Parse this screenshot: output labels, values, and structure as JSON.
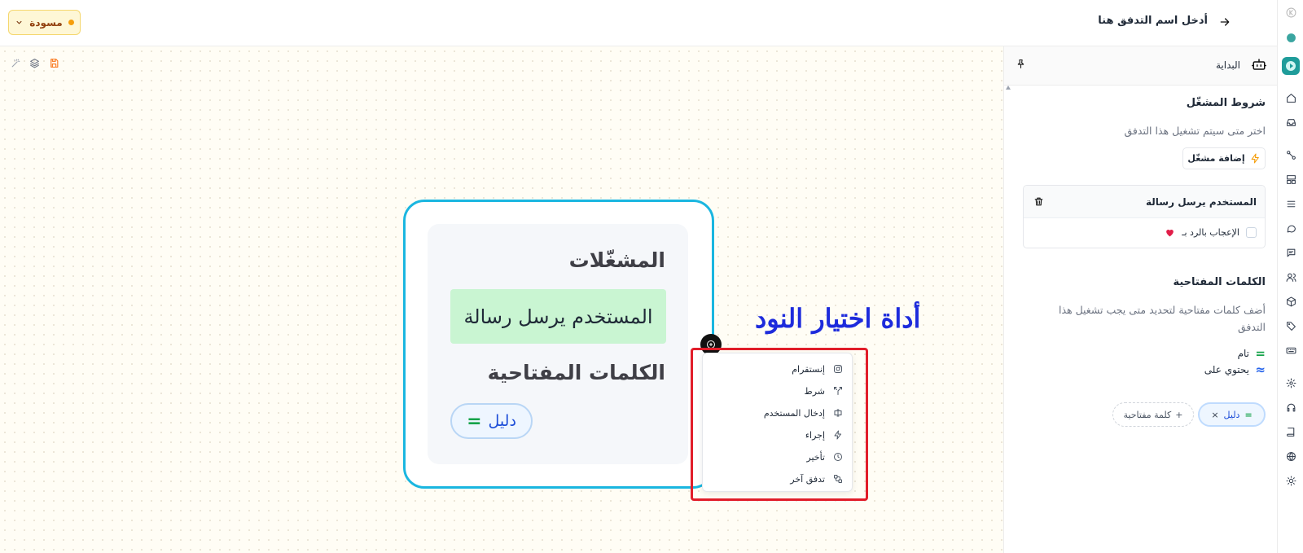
{
  "header": {
    "flow_name": "أدخل اسم التدفق هنا",
    "status": "مسودة"
  },
  "node": {
    "triggers_title": "المشغّلات",
    "trigger": "المستخدم يرسل رسالة",
    "keywords_title": "الكلمات المفتاحية",
    "keyword": "دليل",
    "keyword_symbol": "="
  },
  "annotation": "أداة اختيار النود",
  "picker": {
    "items": [
      {
        "label": "إنستقرام",
        "icon": "instagram-icon"
      },
      {
        "label": "شرط",
        "icon": "split-icon"
      },
      {
        "label": "إدخال المستخدم",
        "icon": "text-cursor-icon"
      },
      {
        "label": "إجراء",
        "icon": "zap-icon"
      },
      {
        "label": "تأخير",
        "icon": "clock-icon"
      },
      {
        "label": "تدفق آخر",
        "icon": "workflow-icon"
      }
    ]
  },
  "panel": {
    "title": "البداية",
    "triggers_heading": "شروط المشغّل",
    "triggers_desc": "اختر متى سيتم تشغيل هذا التدفق",
    "add_trigger": "إضافة مشغّل",
    "trigger_card_title": "المستخدم يرسل رسالة",
    "like_reply": "الإعجاب بالرد بـ",
    "keywords_heading": "الكلمات المفتاحية",
    "keywords_desc": "أضف كلمات مفتاحية لتحديد متى يجب تشغيل هذا التدفق",
    "match_exact": "تام",
    "match_exact_symbol": "=",
    "match_contains": "يحتوي على",
    "match_contains_symbol": "≈",
    "keyword_tag": "دليل",
    "keyword_tag_symbol": "=",
    "keyword_tag_remove": "×",
    "add_keyword": "كلمة مفتاحية",
    "add_keyword_symbol": "+"
  },
  "colors": {
    "accent": "#1ab6e0",
    "status_bg": "#fef7d6",
    "annotation": "#1d2bdc",
    "highlight": "#e11d2a",
    "trigger_green": "#c9f5d2"
  }
}
